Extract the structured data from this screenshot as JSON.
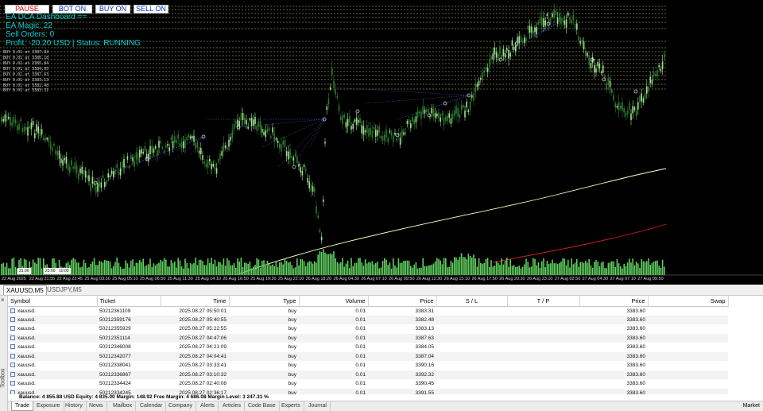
{
  "colors": {
    "chart_bg": "#000000",
    "candle_up": "#9fe08f",
    "candle_down": "#2d7a2d",
    "level_line": "#ffff80",
    "trade_link": "#4060c0",
    "ma_slow": "#ffffc0",
    "ma_red": "#d02020",
    "dashboard_text": "#00d0d0"
  },
  "ea_panel": {
    "pause_label": "PAUSE",
    "bot_label": "BOT ON",
    "buy_label": "BUY ON",
    "sell_label": "SELL ON",
    "title": "EA DCA Dashboard ==",
    "magic": "EA Magic: 22",
    "sell_orders": "Sell Orders: 0",
    "profit_status": "Profit: -20.20 USD | Status: RUNNING"
  },
  "level_labels": [
    "BUY 0.01 at 3387.04",
    "BUY 0.01 at 3386.18",
    "BUY 0.01 at 3385.84",
    "BUY 0.01 at 3384.05",
    "BUY 0.01 at 3387.63",
    "BUY 0.01 at 3383.13",
    "BUY 0.01 at 3382.48",
    "BUY 0.01 at 3383.31"
  ],
  "time_axis": [
    "22 Aug 2025",
    "22 Aug 21:55",
    "22 Aug 23:45",
    "25 Aug 03:30",
    "25 Aug 05:10",
    "25 Aug 06:50",
    "25 Aug 11:30",
    "25 Aug 14:10",
    "25 Aug 16:50",
    "25 Aug 19:30",
    "25 Aug 22:10",
    "26 Aug 18:20",
    "26 Aug 04:30",
    "26 Aug 07:10",
    "26 Aug 09:50",
    "26 Aug 12:30",
    "26 Aug 15:10",
    "26 Aug 17:50",
    "26 Aug 20:30",
    "26 Aug 23:10",
    "27 Aug 02:50",
    "27 Aug 04:30",
    "27 Aug 07:10",
    "27 Aug 09:50"
  ],
  "mini_boxes": [
    "21:00",
    "23:00",
    "10:00"
  ],
  "chart_tabs": [
    "XAUUSD,M5",
    "USDJPY,M5"
  ],
  "table": {
    "columns": [
      "Symbol",
      "Ticket",
      "Time",
      "Type",
      "Volume",
      "Price",
      "S / L",
      "T / P",
      "Price",
      "Swap"
    ],
    "rows": [
      {
        "symbol": "xauusd.",
        "ticket": "50212361109",
        "time": "2025.08.27 05:50:01",
        "type": "buy",
        "volume": "0.01",
        "price": "3383.31",
        "sl": "",
        "tp": "",
        "cur_price": "3383.60",
        "swap": ""
      },
      {
        "symbol": "xauusd.",
        "ticket": "50212359176",
        "time": "2025.08.27 05:40:55",
        "type": "buy",
        "volume": "0.01",
        "price": "3382.48",
        "sl": "",
        "tp": "",
        "cur_price": "3383.60",
        "swap": ""
      },
      {
        "symbol": "xauusd.",
        "ticket": "50212355929",
        "time": "2025.08.27 05:22:55",
        "type": "buy",
        "volume": "0.01",
        "price": "3383.13",
        "sl": "",
        "tp": "",
        "cur_price": "3383.60",
        "swap": ""
      },
      {
        "symbol": "xauusd.",
        "ticket": "50212351114",
        "time": "2025.08.27 04:47:06",
        "type": "buy",
        "volume": "0.01",
        "price": "3387.63",
        "sl": "",
        "tp": "",
        "cur_price": "3383.60",
        "swap": ""
      },
      {
        "symbol": "xauusd.",
        "ticket": "50212346008",
        "time": "2025.08.27 04:21:09",
        "type": "buy",
        "volume": "0.01",
        "price": "3384.05",
        "sl": "",
        "tp": "",
        "cur_price": "3383.60",
        "swap": ""
      },
      {
        "symbol": "xauusd.",
        "ticket": "50212342077",
        "time": "2025.08.27 04:04:41",
        "type": "buy",
        "volume": "0.01",
        "price": "3387.04",
        "sl": "",
        "tp": "",
        "cur_price": "3383.60",
        "swap": ""
      },
      {
        "symbol": "xauusd.",
        "ticket": "50212338041",
        "time": "2025.08.27 03:33:41",
        "type": "buy",
        "volume": "0.01",
        "price": "3390.16",
        "sl": "",
        "tp": "",
        "cur_price": "3383.60",
        "swap": ""
      },
      {
        "symbol": "xauusd.",
        "ticket": "50212336867",
        "time": "2025.08.27 03:10:32",
        "type": "buy",
        "volume": "0.01",
        "price": "3392.32",
        "sl": "",
        "tp": "",
        "cur_price": "3383.60",
        "swap": ""
      },
      {
        "symbol": "xauusd.",
        "ticket": "50212334424",
        "time": "2025.08.27 02:40:08",
        "type": "buy",
        "volume": "0.01",
        "price": "3390.45",
        "sl": "",
        "tp": "",
        "cur_price": "3383.60",
        "swap": ""
      },
      {
        "symbol": "xauusd.",
        "ticket": "50212334245",
        "time": "2025.08.27 02:36:17",
        "type": "buy",
        "volume": "0.01",
        "price": "3391.55",
        "sl": "",
        "tp": "",
        "cur_price": "3383.60",
        "swap": ""
      }
    ]
  },
  "status_line": "Balance: 4 855.88 USD  Equity: 4 835.00  Margin: 148.92  Free Margin: 4 686.08  Margin Level: 3 247.31 %",
  "toolbox_label": "Toolbox",
  "close_symbol": "×",
  "bottom_tabs": [
    "Trade",
    "Exposure",
    "History",
    "News",
    "Mailbox",
    "Calendar",
    "Company",
    "Alerts",
    "Articles",
    "Code Base",
    "Experts",
    "Journal"
  ],
  "market_label": "Market"
}
